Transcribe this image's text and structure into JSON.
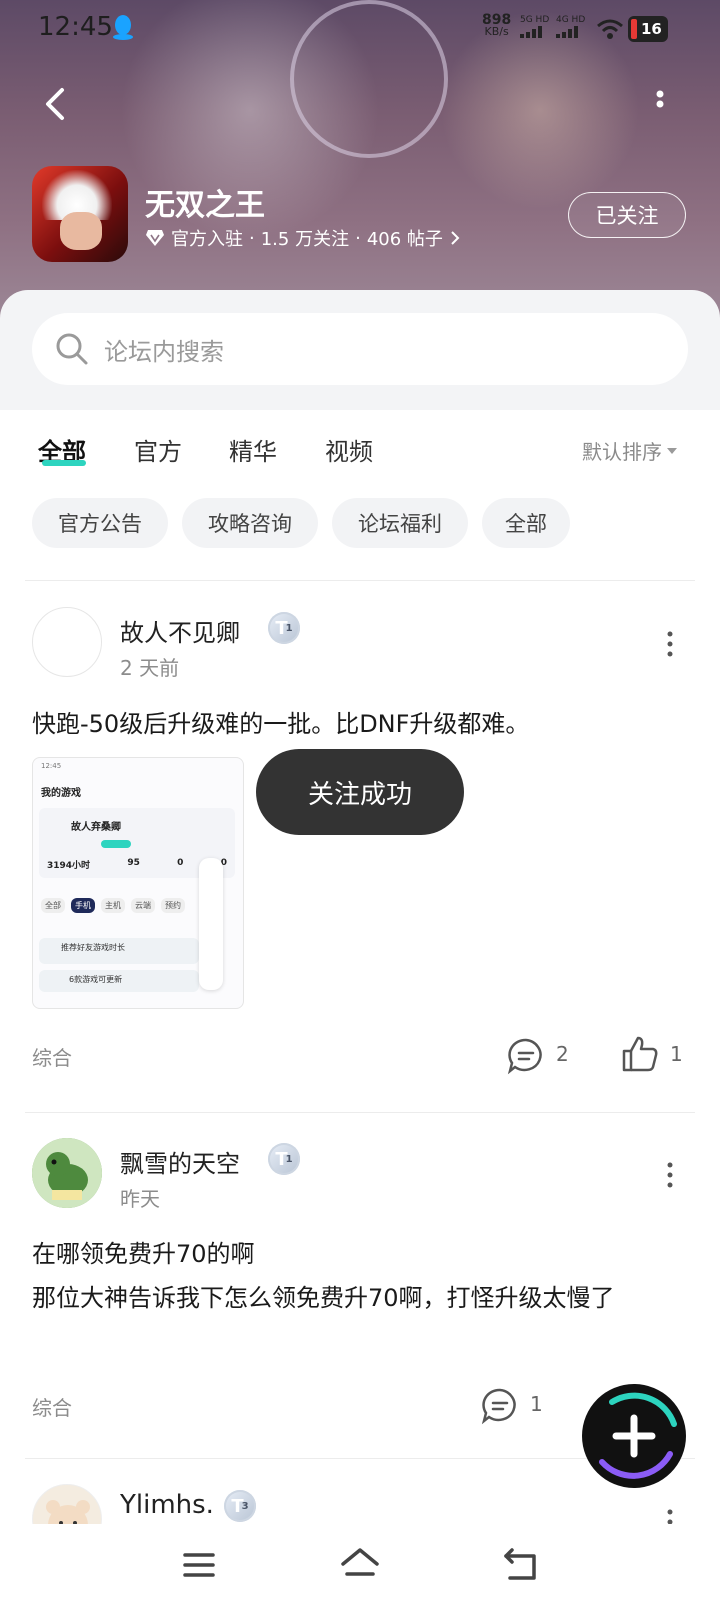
{
  "status_bar": {
    "time": "12:45",
    "net_speed": "898",
    "net_unit": "KB/s",
    "sig1": "5G HD",
    "sig2": "4G HD",
    "battery": "16"
  },
  "header": {
    "forum_name": "无双之王",
    "official_label": "官方入驻",
    "followers": "1.5 万关注",
    "posts": "406 帖子",
    "follow_button": "已关注"
  },
  "search": {
    "placeholder": "论坛内搜索"
  },
  "tabs": [
    {
      "label": "全部",
      "active": true
    },
    {
      "label": "官方"
    },
    {
      "label": "精华"
    },
    {
      "label": "视频"
    }
  ],
  "sort_label": "默认排序",
  "chips": [
    "官方公告",
    "攻略咨询",
    "论坛福利",
    "全部"
  ],
  "posts": [
    {
      "user": "故人不见卿",
      "level": "1",
      "time": "2 天前",
      "title": "快跑-50级后升级难的一批。比DNF升级都难。",
      "tag": "综合",
      "comments": "2",
      "likes": "1",
      "thumb": {
        "header": "我的游戏",
        "name": "故人弃桑卿",
        "stats": [
          "3194小时",
          "95",
          "0",
          "0"
        ],
        "pills": [
          "全部",
          "手机",
          "主机",
          "云端",
          "预约"
        ],
        "row1": "推荐好友游戏时长",
        "row2": "6款游戏可更新"
      }
    },
    {
      "user": "飘雪的天空",
      "level": "1",
      "time": "昨天",
      "title": "在哪领免费升70的啊",
      "body": "那位大神告诉我下怎么领免费升70啊，打怪升级太慢了",
      "tag": "综合",
      "comments": "1"
    },
    {
      "user": "Ylimhs.",
      "level": "3"
    }
  ],
  "toast": "关注成功",
  "colors": {
    "accent": "#2dd4bf",
    "toast_bg": "#333333",
    "fab_bg": "#111111"
  }
}
